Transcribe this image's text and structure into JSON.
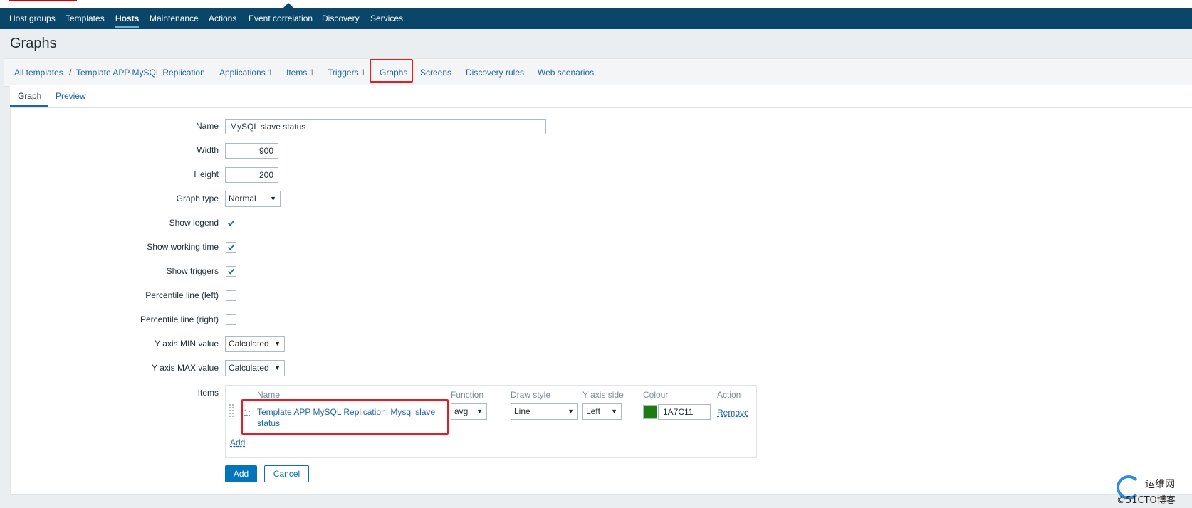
{
  "top_nav": {
    "items": [
      {
        "label": "Host groups",
        "active": false
      },
      {
        "label": "Templates",
        "active": false
      },
      {
        "label": "Hosts",
        "active": true
      },
      {
        "label": "Maintenance",
        "active": false
      },
      {
        "label": "Actions",
        "active": false
      },
      {
        "label": "Event correlation",
        "active": false
      },
      {
        "label": "Discovery",
        "active": false
      },
      {
        "label": "Services",
        "active": false
      }
    ]
  },
  "page": {
    "title": "Graphs"
  },
  "breadcrumb": {
    "all_templates": "All templates",
    "separator": "/",
    "template": "Template APP MySQL Replication",
    "applications": {
      "label": "Applications",
      "count": "1"
    },
    "items": {
      "label": "Items",
      "count": "1"
    },
    "triggers": {
      "label": "Triggers",
      "count": "1"
    },
    "graphs": "Graphs",
    "screens": "Screens",
    "discovery_rules": "Discovery rules",
    "web_scenarios": "Web scenarios"
  },
  "tabs": {
    "graph": "Graph",
    "preview": "Preview"
  },
  "form": {
    "name": {
      "label": "Name",
      "value": "MySQL slave status"
    },
    "width": {
      "label": "Width",
      "value": "900"
    },
    "height": {
      "label": "Height",
      "value": "200"
    },
    "graph_type": {
      "label": "Graph type",
      "value": "Normal"
    },
    "show_legend": {
      "label": "Show legend",
      "checked": true
    },
    "show_working_time": {
      "label": "Show working time",
      "checked": true
    },
    "show_triggers": {
      "label": "Show triggers",
      "checked": true
    },
    "percentile_left": {
      "label": "Percentile line (left)",
      "checked": false
    },
    "percentile_right": {
      "label": "Percentile line (right)",
      "checked": false
    },
    "y_min": {
      "label": "Y axis MIN value",
      "value": "Calculated"
    },
    "y_max": {
      "label": "Y axis MAX value",
      "value": "Calculated"
    },
    "items_label": "Items"
  },
  "items_table": {
    "headers": {
      "name": "Name",
      "function": "Function",
      "draw_style": "Draw style",
      "y_axis_side": "Y axis side",
      "colour": "Colour",
      "action": "Action"
    },
    "rows": [
      {
        "index": "1:",
        "name": "Template APP MySQL Replication: Mysql slave status",
        "function": "avg",
        "draw_style": "Line",
        "y_axis_side": "Left",
        "colour": "1A7C11",
        "action": "Remove"
      }
    ],
    "add_link": "Add"
  },
  "buttons": {
    "add": "Add",
    "cancel": "Cancel"
  },
  "watermark": {
    "line1": "运维网",
    "line2": "©51CTO博客"
  },
  "colors": {
    "nav_bg": "#0a466a",
    "link": "#1f65a6",
    "primary": "#0275b8",
    "highlight": "#e51c23",
    "item_colour": "#1A7C11"
  }
}
